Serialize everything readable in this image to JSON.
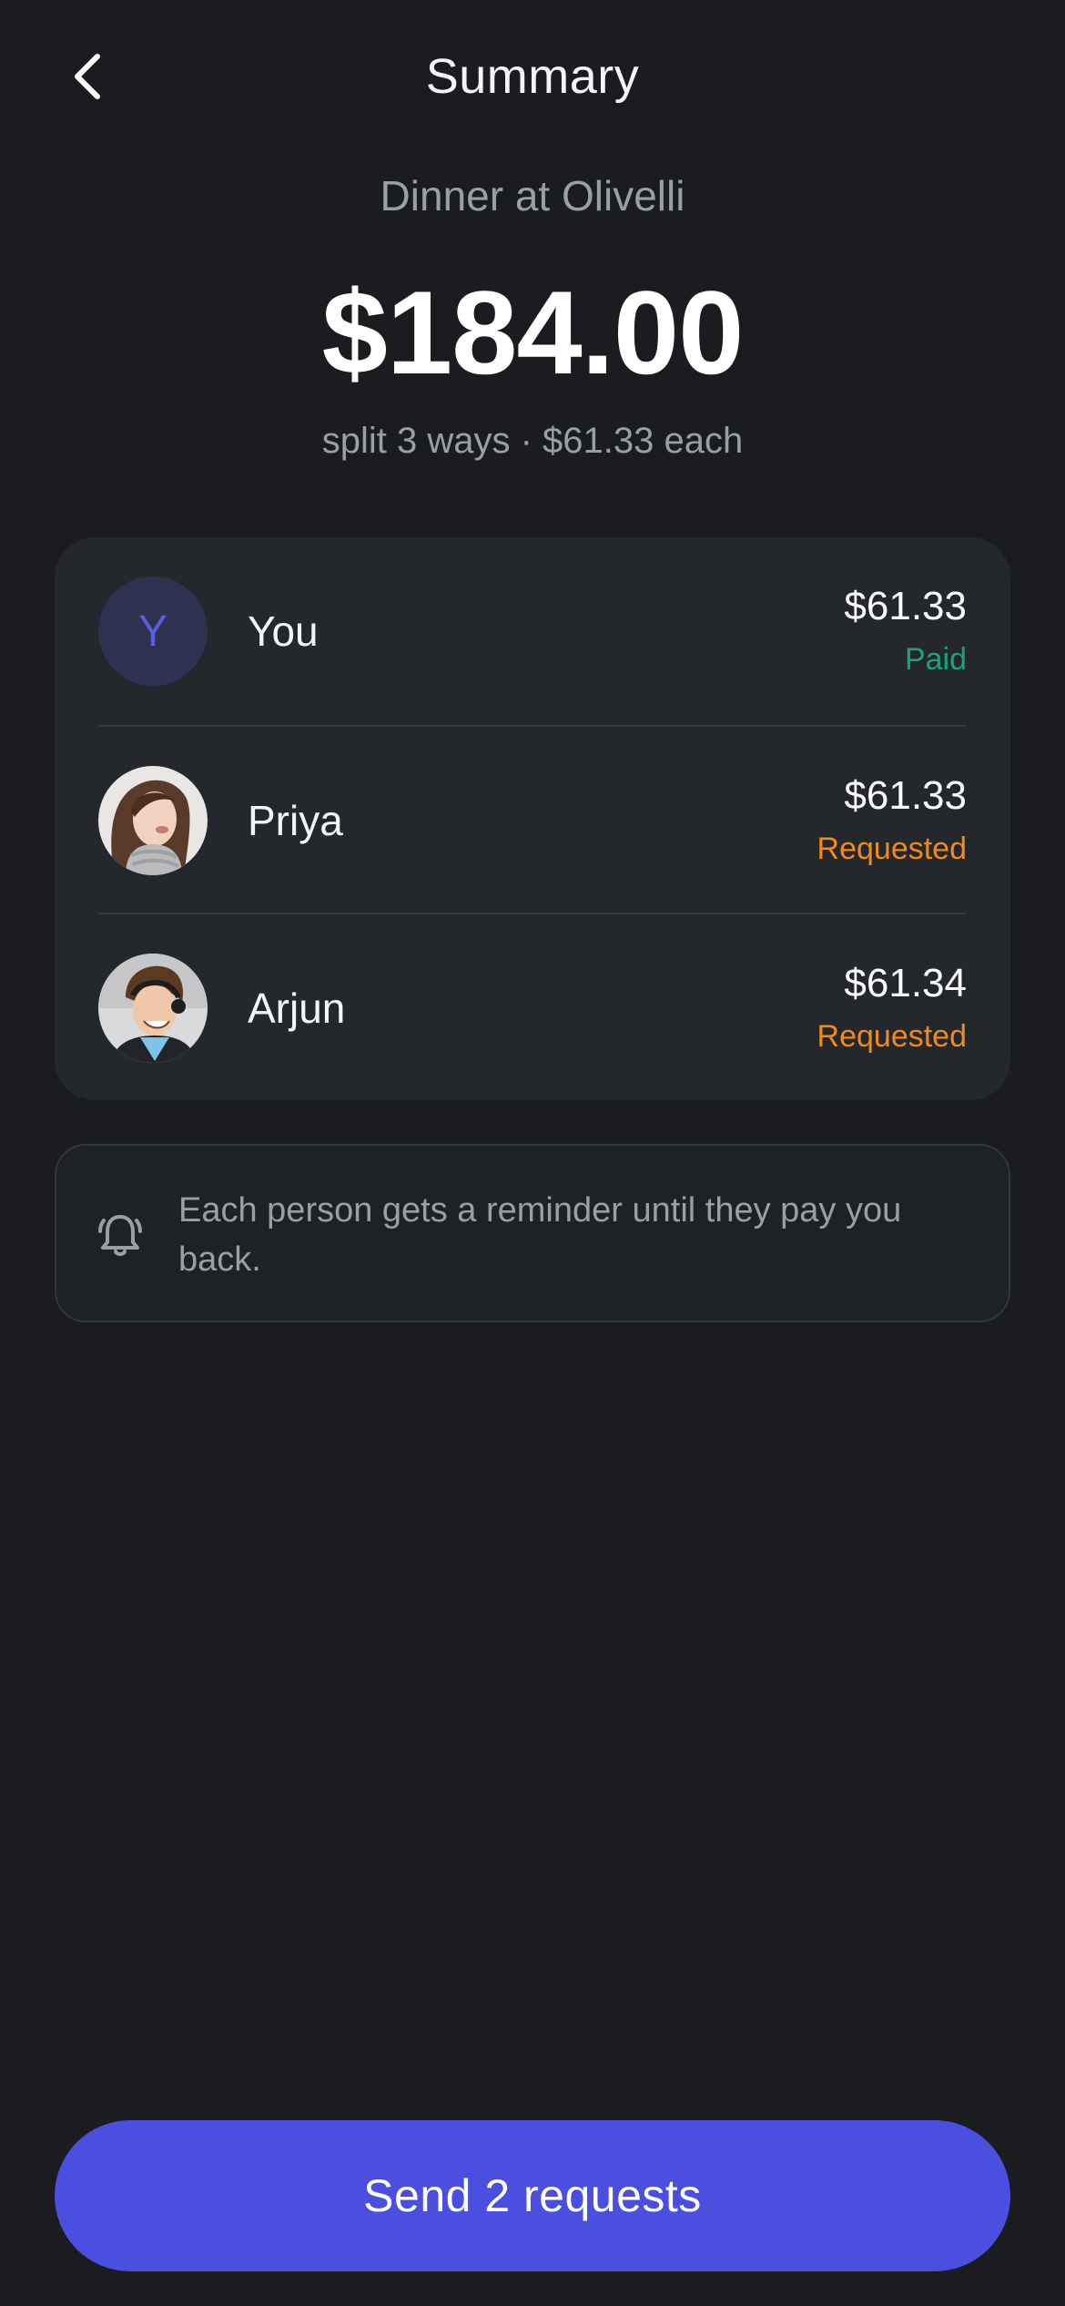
{
  "header": {
    "title": "Summary",
    "back_icon": "chevron-left-icon"
  },
  "summary": {
    "event_name": "Dinner at Olivelli",
    "total": "$184.00",
    "split_text": "split 3 ways · $61.33 each"
  },
  "people": [
    {
      "name": "You",
      "initial": "Y",
      "amount": "$61.33",
      "status": "Paid",
      "status_color": "#1aa37a",
      "avatar": "initial-avatar"
    },
    {
      "name": "Priya",
      "amount": "$61.33",
      "status": "Requested",
      "status_color": "#f08a1c",
      "avatar": "photo-avatar"
    },
    {
      "name": "Arjun",
      "amount": "$61.34",
      "status": "Requested",
      "status_color": "#f08a1c",
      "avatar": "photo-avatar"
    }
  ],
  "reminder": {
    "icon": "bell-icon",
    "text": "Each person gets a reminder until they pay you back."
  },
  "cta": {
    "label": "Send 2 requests",
    "color": "#4a4fe0"
  }
}
